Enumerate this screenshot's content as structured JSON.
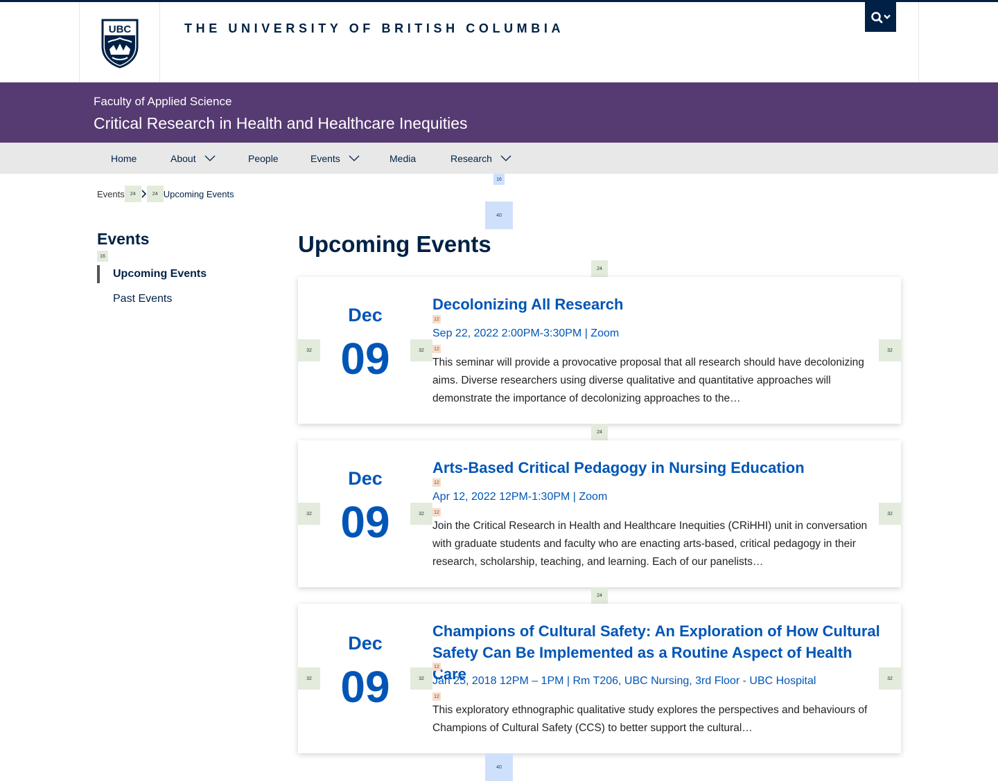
{
  "header": {
    "wordmark": "THE UNIVERSITY OF BRITISH COLUMBIA",
    "crest_text": "UBC"
  },
  "unit": {
    "faculty": "Faculty of Applied Science",
    "name": "Critical Research in Health and Healthcare Inequities"
  },
  "nav": {
    "items": [
      {
        "label": "Home"
      },
      {
        "label": "About"
      },
      {
        "label": "People"
      },
      {
        "label": "Events"
      },
      {
        "label": "Media"
      },
      {
        "label": "Research"
      }
    ]
  },
  "breadcrumb": {
    "parent": "Events",
    "current": "Upcoming Events"
  },
  "sidebar": {
    "title": "Events",
    "items": [
      {
        "label": "Upcoming Events"
      },
      {
        "label": "Past Events"
      }
    ]
  },
  "main": {
    "title": "Upcoming Events",
    "events": [
      {
        "month": "Dec",
        "day": "09",
        "title": "Decolonizing All Research",
        "meta": "Sep 22, 2022 2:00PM-3:30PM | Zoom",
        "desc": "This seminar will provide a provocative proposal that all research should have decolonizing aims. Diverse researchers using diverse qualitative and quantitative approaches will demonstrate the importance of decolonizing approaches to the…"
      },
      {
        "month": "Dec",
        "day": "09",
        "title": "Arts-Based Critical Pedagogy in Nursing Education",
        "meta": "Apr 12, 2022 12PM-1:30PM | Zoom",
        "desc": "Join the Critical Research in Health and Healthcare Inequities (CRiHHI) unit in conversation with graduate students and faculty who are enacting arts-based, critical pedagogy in their research, scholarship, teaching, and learning. Each of our panelists…"
      },
      {
        "month": "Dec",
        "day": "09",
        "title": "Champions of Cultural Safety: An Exploration of How Cultural Safety Can Be Implemented as a Routine Aspect of Health Care",
        "meta": "Jan 25, 2018 12PM – 1PM  |  Rm T206, UBC Nursing, 3rd Floor - UBC Hospital",
        "desc": "This exploratory ethnographic qualitative study explores the perspectives and behaviours of Champions of Cultural Safety (CCS) to better support the cultural…"
      }
    ]
  },
  "spacers": {
    "s16": "16",
    "s24": "24",
    "s32": "32",
    "s40": "40",
    "s12": "12"
  },
  "colors": {
    "ubc_blue": "#002145",
    "link_blue": "#0055b7",
    "unit_purple": "#563a72",
    "nav_grey": "#e8e8e8"
  }
}
